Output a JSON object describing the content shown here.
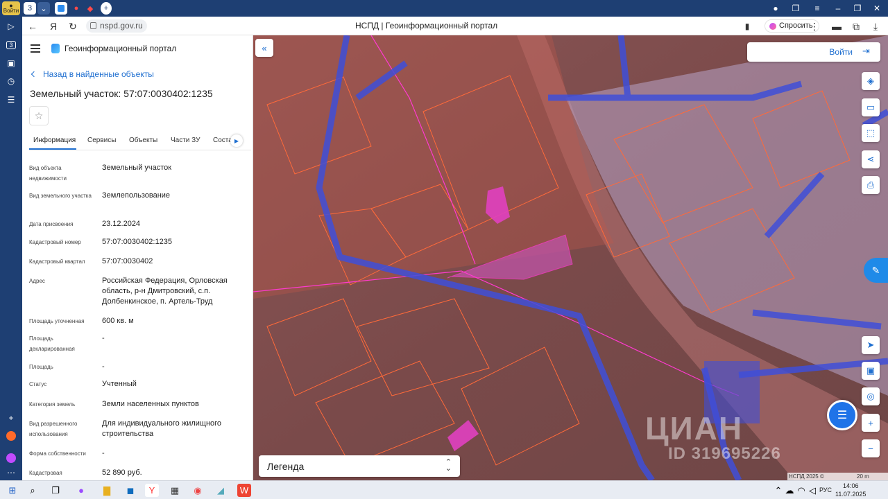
{
  "browser": {
    "profile_label": "Войти",
    "tab_count": "3",
    "url": "nspd.gov.ru",
    "page_title": "НСПД | Геоинформационный портал",
    "ask_label": "Спросить"
  },
  "rail": {
    "items": [
      "play-icon",
      "three-badge",
      "camera-icon",
      "clock-icon",
      "notes-icon"
    ],
    "three_label": "3"
  },
  "panel": {
    "brand": "Геоинформационный портал",
    "back_label": "Назад в найденные объекты",
    "title": "Земельный участок: 57:07:0030402:1235",
    "tabs": [
      "Информация",
      "Сервисы",
      "Объекты",
      "Части ЗУ",
      "Соста"
    ],
    "rows": [
      {
        "key": "Вид объекта недвижимости",
        "value": "Земельный участок"
      },
      {
        "key": "Вид земельного участка",
        "value": "Землепользование"
      },
      {
        "key": "Дата присвоения",
        "value": "23.12.2024"
      },
      {
        "key": "Кадастровый номер",
        "value": "57:07:0030402:1235"
      },
      {
        "key": "Кадастровый квартал",
        "value": "57:07:0030402"
      },
      {
        "key": "Адрес",
        "value": "Российская Федерация, Орловская область, р-н Дмитровский, с.п. Долбенкинское, п. Артель-Труд"
      },
      {
        "key": "Площадь уточненная",
        "value": "600 кв. м"
      },
      {
        "key": "Площадь декларированная",
        "value": "-"
      },
      {
        "key": "Площадь",
        "value": "-"
      },
      {
        "key": "Статус",
        "value": "Учтенный"
      },
      {
        "key": "Категория земель",
        "value": "Земли населенных пунктов"
      },
      {
        "key": "Вид разрешенного использования",
        "value": "Для индивидуального жилищного строительства"
      },
      {
        "key": "Форма собственности",
        "value": "-"
      },
      {
        "key": "Кадастровая",
        "value": "52 890 руб."
      }
    ]
  },
  "map": {
    "login_label": "Войти",
    "legend_label": "Легенда",
    "watermark": "ЦИАН",
    "watermark_id": "ID 319695226",
    "copyright": "НСПД 2025 ©",
    "scale": "20 m",
    "accent": "#1f6fd0"
  },
  "taskbar": {
    "lang": "РУС",
    "time": "14:06",
    "date": "11.07.2025"
  }
}
